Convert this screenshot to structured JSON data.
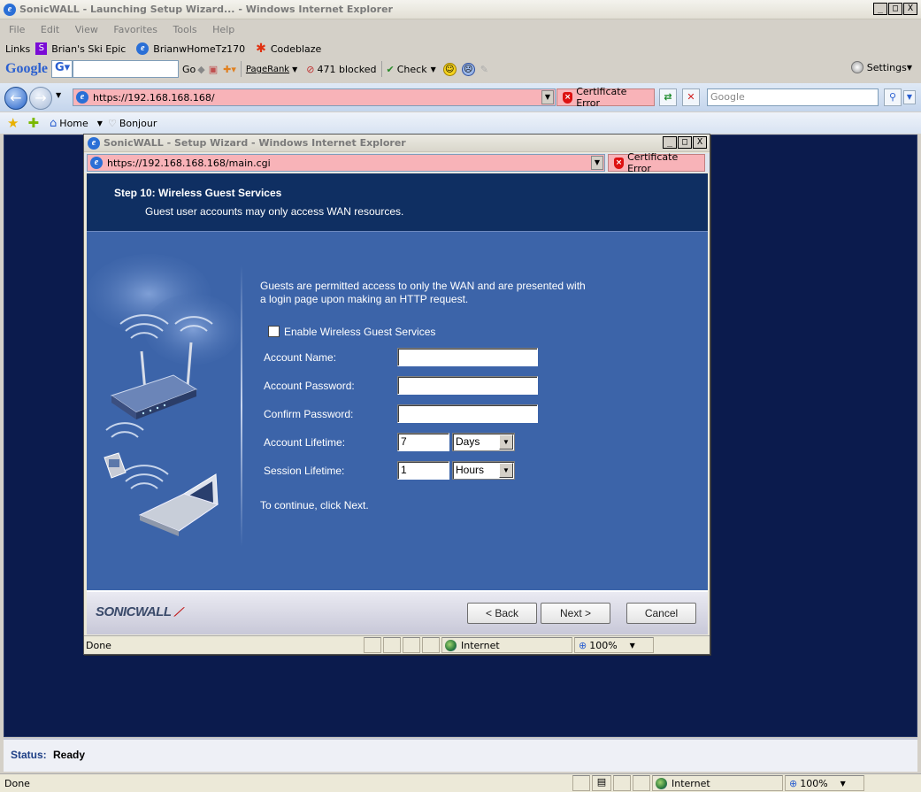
{
  "outer_window": {
    "title": "SonicWALL - Launching Setup Wizard... - Windows Internet Explorer",
    "controls": [
      "_",
      "□",
      "X"
    ]
  },
  "menu": {
    "file": "File",
    "edit": "Edit",
    "view": "View",
    "favorites": "Favorites",
    "tools": "Tools",
    "help": "Help"
  },
  "links_bar": {
    "label": "Links",
    "items": [
      "Brian's Ski Epic",
      "BrianwHomeTz170",
      "Codeblaze"
    ]
  },
  "google_toolbar": {
    "logo": "Google",
    "go": "Go",
    "pagerank": "PageRank",
    "blocked": "471 blocked",
    "check": "Check",
    "settings": "Settings"
  },
  "address_bar": {
    "url": "https://192.168.168.168/",
    "cert_error": "Certificate Error",
    "search_placeholder": "Google"
  },
  "favorites_bar": {
    "home": "Home",
    "bonjour": "Bonjour"
  },
  "popup": {
    "title": "SonicWALL - Setup Wizard - Windows Internet Explorer",
    "url": "https://192.168.168.168/main.cgi",
    "cert_error": "Certificate Error",
    "status": "Done",
    "zone": "Internet",
    "zoom": "100%"
  },
  "wizard": {
    "step_title": "Step 10: Wireless Guest Services",
    "step_subtitle": "Guest user accounts may only access WAN resources.",
    "intro_line1": "Guests are permitted access to only the WAN and are presented with",
    "intro_line2": "a login page upon making an HTTP request.",
    "enable_label": "Enable Wireless Guest Services",
    "enable_checked": false,
    "account_name_label": "Account Name:",
    "account_name_value": "",
    "account_password_label": "Account Password:",
    "account_password_value": "",
    "confirm_password_label": "Confirm Password:",
    "confirm_password_value": "",
    "account_lifetime_label": "Account Lifetime:",
    "account_lifetime_value": "7",
    "account_lifetime_unit": "Days",
    "session_lifetime_label": "Session Lifetime:",
    "session_lifetime_value": "1",
    "session_lifetime_unit": "Hours",
    "continue_text": "To continue, click Next.",
    "logo": "SONICWALL",
    "back": "< Back",
    "next": "Next >",
    "cancel": "Cancel"
  },
  "page_status": {
    "label": "Status:",
    "value": "Ready"
  },
  "main_statusbar": {
    "status": "Done",
    "zone": "Internet",
    "zoom": "100%"
  },
  "colors": {
    "page_background": "#0b1b4d",
    "wizard_header": "#0f2f62",
    "wizard_body": "#3c64a9",
    "cert_error_bg": "#f8b3b8"
  }
}
